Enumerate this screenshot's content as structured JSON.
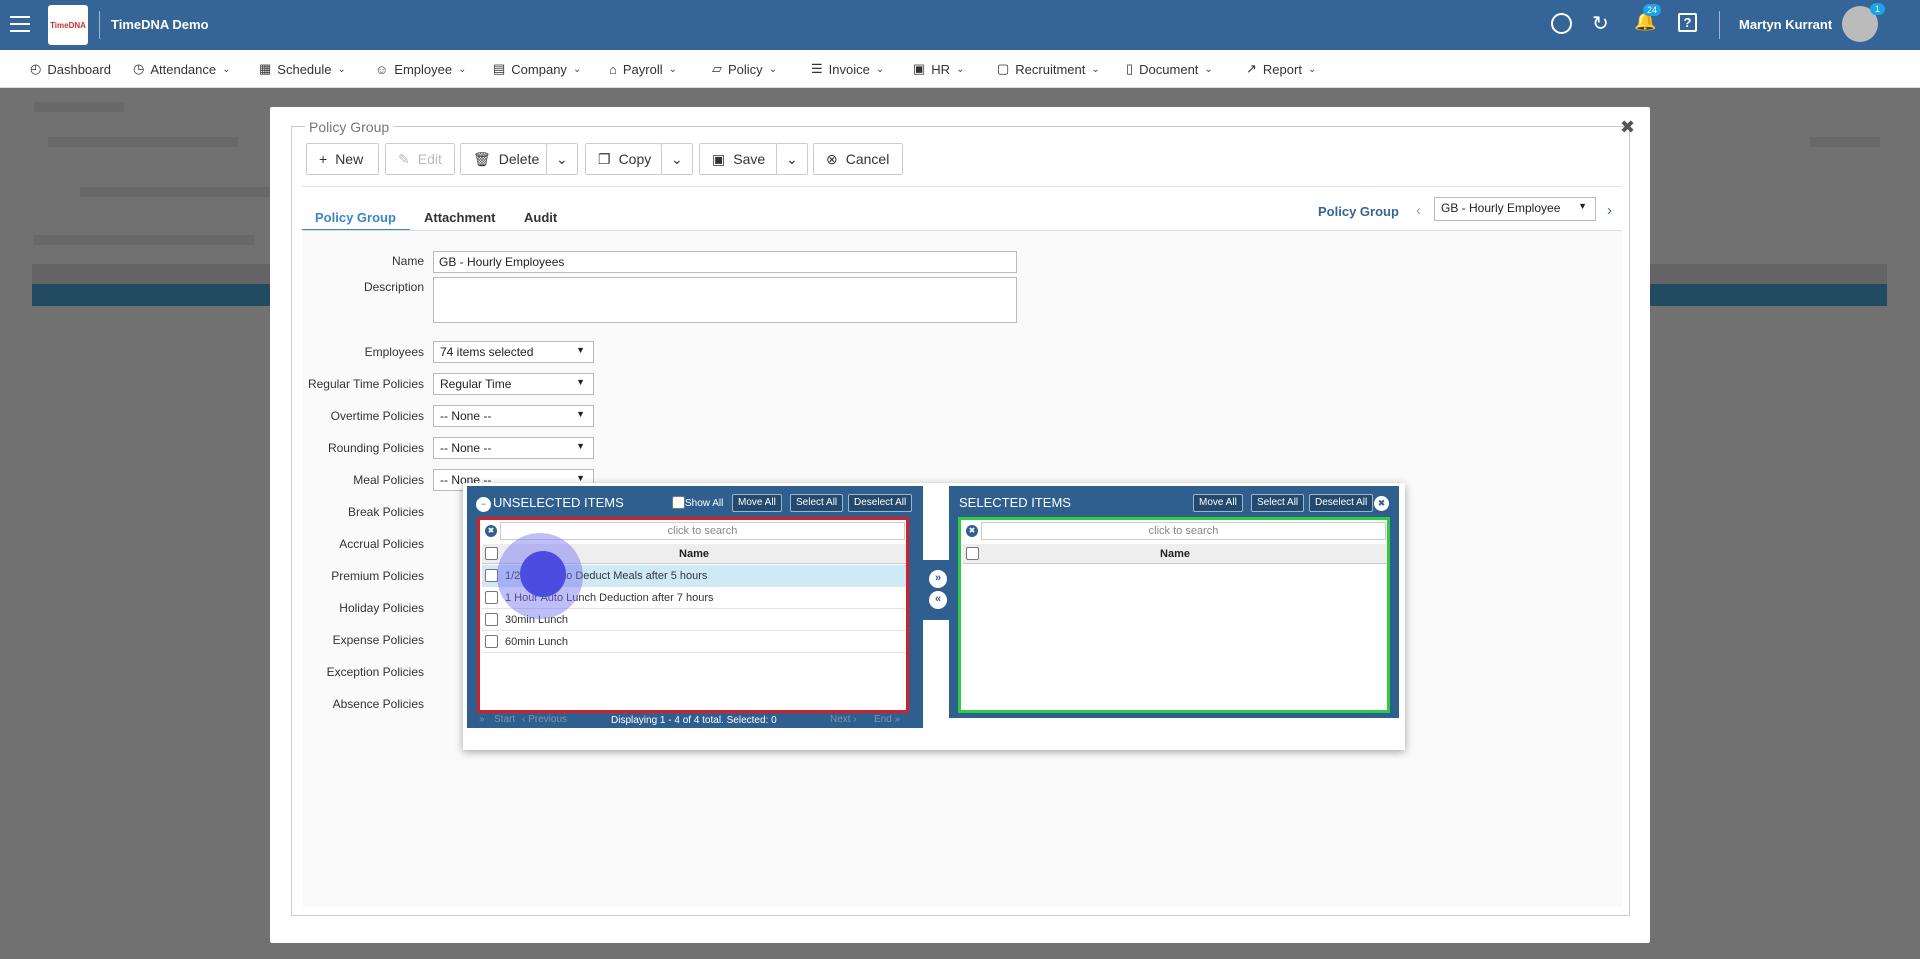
{
  "app": {
    "title": "TimeDNA Demo",
    "logo_text": "TimeDNA"
  },
  "topbar": {
    "notifications_count": "24",
    "user_name": "Martyn Kurrant",
    "avatar_badge": "1"
  },
  "menu": [
    {
      "label": "Dashboard",
      "icon": "gauge-icon"
    },
    {
      "label": "Attendance",
      "icon": "clock-icon"
    },
    {
      "label": "Schedule",
      "icon": "calendar-icon"
    },
    {
      "label": "Employee",
      "icon": "people-icon"
    },
    {
      "label": "Company",
      "icon": "building-icon"
    },
    {
      "label": "Payroll",
      "icon": "bank-icon"
    },
    {
      "label": "Policy",
      "icon": "policy-icon"
    },
    {
      "label": "Invoice",
      "icon": "invoice-icon"
    },
    {
      "label": "HR",
      "icon": "briefcase-icon"
    },
    {
      "label": "Recruitment",
      "icon": "recruitment-icon"
    },
    {
      "label": "Document",
      "icon": "document-icon"
    },
    {
      "label": "Report",
      "icon": "chart-icon"
    }
  ],
  "modal": {
    "legend": "Policy Group",
    "toolbar": {
      "new": "New",
      "edit": "Edit",
      "delete": "Delete",
      "copy": "Copy",
      "save": "Save",
      "cancel": "Cancel"
    },
    "tabs": [
      "Policy Group",
      "Attachment",
      "Audit"
    ],
    "nav": {
      "label": "Policy Group",
      "selected": "GB - Hourly Employee"
    },
    "form": {
      "name_label": "Name",
      "name_value": "GB - Hourly Employees",
      "description_label": "Description",
      "description_value": "",
      "employees_label": "Employees",
      "employees_value": "74 items selected",
      "regular_label": "Regular Time Policies",
      "regular_value": "Regular Time",
      "overtime_label": "Overtime Policies",
      "overtime_value": "-- None --",
      "rounding_label": "Rounding Policies",
      "rounding_value": "-- None --",
      "meal_label": "Meal Policies",
      "meal_value": "-- None --",
      "break_label": "Break Policies",
      "accrual_label": "Accrual Policies",
      "premium_label": "Premium Policies",
      "holiday_label": "Holiday Policies",
      "expense_label": "Expense Policies",
      "exception_label": "Exception Policies",
      "absence_label": "Absence Policies"
    }
  },
  "awesomebox": {
    "unselected": {
      "title": "UNSELECTED ITEMS",
      "show_all": "Show All",
      "move_all": "Move All",
      "select_all": "Select All",
      "deselect_all": "Deselect All",
      "search_placeholder": "click to search",
      "column": "Name",
      "rows": [
        "1/2 Hour Auto Deduct Meals after 5 hours",
        "1 Hour Auto Lunch Deduction after 7 hours",
        "30min Lunch",
        "60min Lunch"
      ],
      "pager": {
        "start": "Start",
        "previous": "Previous",
        "status": "Displaying 1 - 4 of 4 total. Selected: 0",
        "next": "Next",
        "end": "End"
      }
    },
    "selected": {
      "title": "SELECTED ITEMS",
      "move_all": "Move All",
      "select_all": "Select All",
      "deselect_all": "Deselect All",
      "search_placeholder": "click to search",
      "column": "Name"
    }
  },
  "colors": {
    "topbar": "#356596",
    "accent": "#3a86c8",
    "unselected_border": "#d0202a",
    "selected_border": "#2ecc40",
    "panel": "#2f5f8f"
  }
}
